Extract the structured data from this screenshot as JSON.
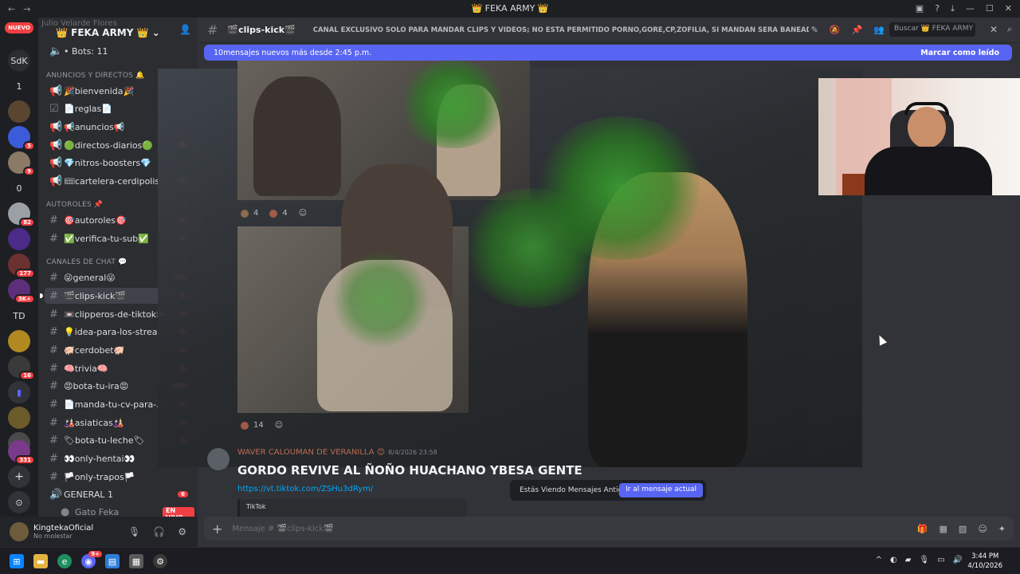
{
  "window": {
    "title": "👑 FEKA ARMY 👑",
    "nav_back": "←",
    "nav_forward": "→",
    "controls": [
      "—",
      "☐",
      "✕"
    ]
  },
  "server": {
    "name": "👑 FEKA ARMY 👑",
    "ghost_text": "Julio Velarde Flores",
    "guild_badge_new": "NUEVO"
  },
  "guilds": [
    {
      "label": "SdK",
      "badge": ""
    },
    {
      "label": "1",
      "badge": ""
    },
    {
      "label": "",
      "badge": ""
    },
    {
      "label": "",
      "badge": "5"
    },
    {
      "label": "",
      "badge": "9"
    },
    {
      "label": "0",
      "badge": ""
    },
    {
      "label": "",
      "badge": "82"
    },
    {
      "label": "",
      "badge": ""
    },
    {
      "label": "",
      "badge": "177"
    },
    {
      "label": "",
      "badge": "3K+"
    },
    {
      "label": "TD",
      "badge": ""
    },
    {
      "label": "",
      "badge": ""
    },
    {
      "label": "",
      "badge": "16"
    },
    {
      "label": "",
      "badge": ""
    },
    {
      "label": "",
      "badge": ""
    },
    {
      "label": "",
      "badge": "331"
    },
    {
      "label": "+",
      "badge": ""
    },
    {
      "label": "⊙",
      "badge": ""
    }
  ],
  "sidebar": {
    "bots_item": "• Bots: 11",
    "categories": {
      "announcements": "ANUNCIOS Y DIRECTOS 🔔",
      "autoroles": "AUTOROLES 📌",
      "chat": "CANALES DE CHAT 💬"
    },
    "channels": [
      {
        "name": "🎉bienvenida🎉",
        "count": ""
      },
      {
        "name": "📄reglas📄",
        "count": ""
      },
      {
        "name": "📢anuncios📢",
        "count": ""
      },
      {
        "name": "🟢directos-diarios🟢",
        "count": "2"
      },
      {
        "name": "💎nitros-boosters💎",
        "count": ""
      },
      {
        "name": "🎟cartelera-cerdipolis🎟",
        "count": "1"
      },
      {
        "name": "🎯autoroles🎯",
        "count": "1"
      },
      {
        "name": "✅verifica-tu-sub✅",
        "count": "1"
      },
      {
        "name": "😜general😜",
        "count": "25"
      },
      {
        "name": "🎬clips-kick🎬",
        "count": "4"
      },
      {
        "name": "📼clipperos-de-tiktok📼",
        "count": "2"
      },
      {
        "name": "💡idea-para-los-streams💡",
        "count": "5"
      },
      {
        "name": "🐖cerdobet🐖",
        "count": "2"
      },
      {
        "name": "🧠trivia🧠",
        "count": "1"
      },
      {
        "name": "😡bota-tu-ira😡",
        "count": "118"
      },
      {
        "name": "📄manda-tu-cv-para-mod...",
        "count": "3"
      },
      {
        "name": "🎎asiaticas🎎",
        "count": "1"
      },
      {
        "name": "🏷bota-tu-leche🏷",
        "count": "1"
      },
      {
        "name": "👀only-hentai👀",
        "count": ""
      },
      {
        "name": "🏳️only-trapos🏳️",
        "count": ""
      },
      {
        "name": "GENERAL 1",
        "count": "6"
      }
    ],
    "live_user": "Gato Feka",
    "live_badge": "EN VIVO"
  },
  "user": {
    "name": "KingtekaOficial",
    "status": "No molestar"
  },
  "channel": {
    "name": "🎬clips-kick🎬",
    "topic": "CANAL EXCLUSIVO SOLO PARA MANDAR CLIPS Y VIDEOS; NO ESTA PERMITIDO PORNO,GORE,CP,ZOFILIA, SI MANDAN SERA BANEADO PERMA.",
    "search_placeholder": "Buscar 👑 FEKA ARMY 👑"
  },
  "banner": {
    "text": "10mensajes nuevos más desde 2:45 p.m.",
    "action": "Marcar como leído"
  },
  "reactions": {
    "first": [
      "4",
      "4"
    ],
    "second": [
      "14"
    ]
  },
  "message": {
    "author": "WAVER CALOUMAN DE VERANILLA 😊",
    "timestamp": "8/4/2026 23:58",
    "title": "GORDO REVIVE AL ÑOÑO HUACHANO YBESA GENTE",
    "link": "https://vt.tiktok.com/ZSHu3dRym/",
    "embed_source": "TikTok"
  },
  "old_messages": {
    "text": "Estás Viendo Mensajes Antiguos",
    "button": "Ir al mensaje actual"
  },
  "composer": {
    "placeholder": "Mensaje # 🎬clips-kick🎬"
  },
  "taskbar": {
    "time": "3:44 PM",
    "date": "4/10/2026",
    "discord_badge": "9+"
  },
  "colors": {
    "blurple": "#5865f2",
    "mention_red": "#f23f43",
    "link_blue": "#00a8fc"
  }
}
